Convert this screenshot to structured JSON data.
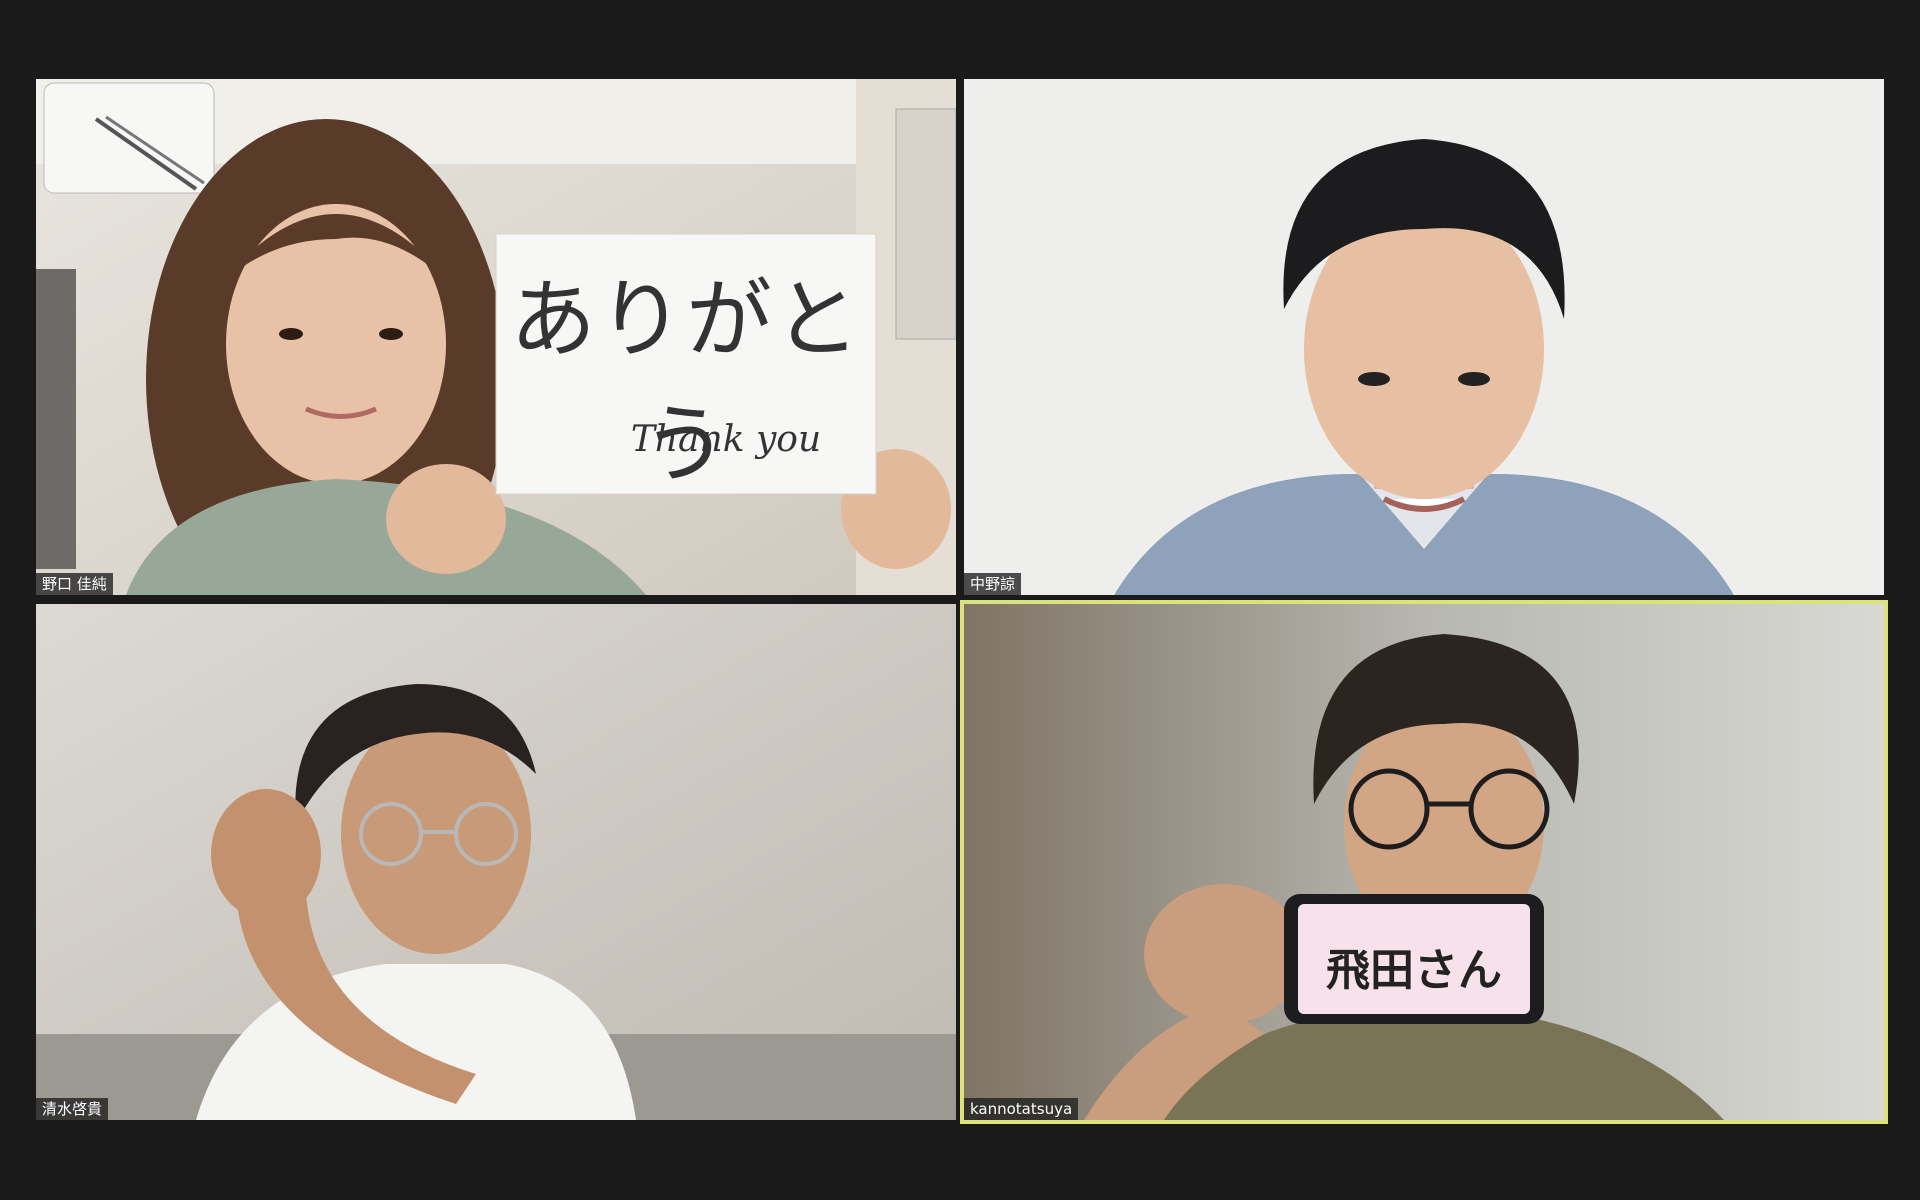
{
  "participants": [
    {
      "name": "野口 佳純",
      "sign_main": "ありがとう",
      "sign_sub": "Thank you"
    },
    {
      "name": "中野諒"
    },
    {
      "name": "清水啓貴"
    },
    {
      "name": "kannotatsuya",
      "phone_text": "飛田さん",
      "active_speaker": true
    }
  ],
  "colors": {
    "background": "#1a1a1a",
    "active_speaker_border": "#d9e37a"
  }
}
